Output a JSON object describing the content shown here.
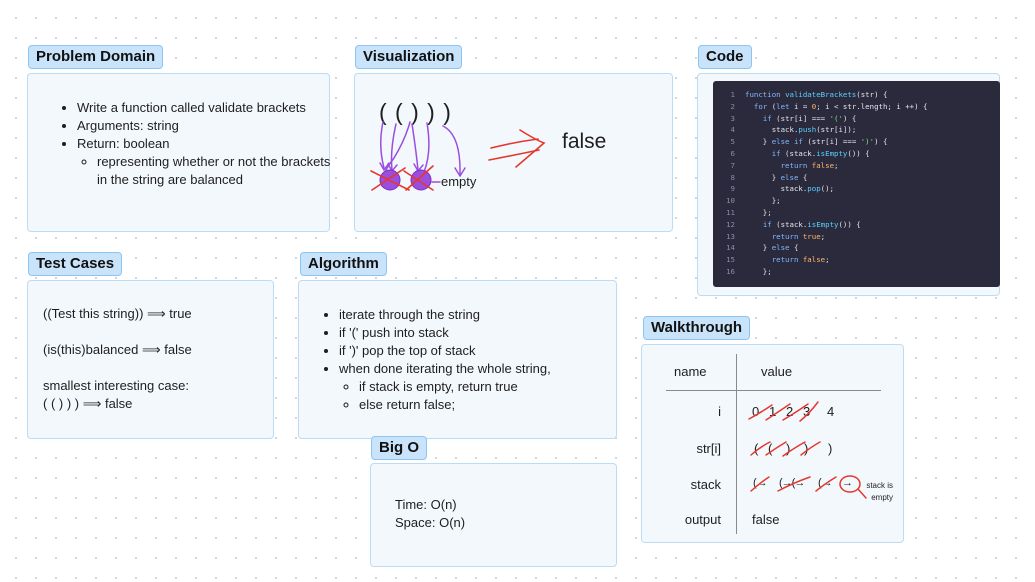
{
  "problem_domain": {
    "title": "Problem Domain",
    "items": [
      "Write a function called validate brackets",
      "Arguments: string",
      "Return: boolean"
    ],
    "sub_item": "representing whether or not the brackets in the string are balanced"
  },
  "visualization": {
    "title": "Visualization",
    "brackets": "( ( ) ) )",
    "empty_label": "empty",
    "result": "false"
  },
  "code": {
    "title": "Code",
    "lines": [
      {
        "n": "1",
        "t": "function validateBrackets(str) {"
      },
      {
        "n": "2",
        "t": "  for (let i = 0; i < str.length; i ++) {"
      },
      {
        "n": "3",
        "t": "    if (str[i] === '(') {"
      },
      {
        "n": "4",
        "t": "      stack.push(str[i]);"
      },
      {
        "n": "5",
        "t": "    } else if (str[i] === ')') {"
      },
      {
        "n": "6",
        "t": "      if (stack.isEmpty()) {"
      },
      {
        "n": "7",
        "t": "        return false;"
      },
      {
        "n": "8",
        "t": "      } else {"
      },
      {
        "n": "9",
        "t": "        stack.pop();"
      },
      {
        "n": "10",
        "t": "      };"
      },
      {
        "n": "11",
        "t": "    };"
      },
      {
        "n": "12",
        "t": "    if (stack.isEmpty()) {"
      },
      {
        "n": "13",
        "t": "      return true;"
      },
      {
        "n": "14",
        "t": "    } else {"
      },
      {
        "n": "15",
        "t": "      return false;"
      },
      {
        "n": "16",
        "t": "    };"
      }
    ]
  },
  "test_cases": {
    "title": "Test Cases",
    "case1": "((Test this string)) ⟹ true",
    "case2": "(is(this)balanced ⟹ false",
    "case3_label": "smallest interesting case:",
    "case3": "( ( ) ) ) ⟹ false"
  },
  "algorithm": {
    "title": "Algorithm",
    "items": [
      "iterate through the string",
      "if '(' push into stack",
      "if ')' pop the top of stack",
      "when done iterating the whole string,"
    ],
    "sub_items": [
      "if stack is empty, return true",
      "else return false;"
    ]
  },
  "big_o": {
    "title": "Big O",
    "time": "Time: O(n)",
    "space": "Space: O(n)"
  },
  "walkthrough": {
    "title": "Walkthrough",
    "header_name": "name",
    "header_value": "value",
    "row_i": "i",
    "i_values": [
      "0",
      "1",
      "2",
      "3",
      "4"
    ],
    "row_str": "str[i]",
    "str_values": [
      "(",
      "(",
      ")",
      ")",
      ")"
    ],
    "row_stack": "stack",
    "stack_values": [
      "(→",
      "(→(→",
      "(→",
      "→"
    ],
    "stack_note": "stack is empty",
    "row_output": "output",
    "output_value": "false"
  },
  "colors": {
    "tag_bg": "#c9e3fb",
    "card_bg": "#f3f8fd",
    "ink_red": "#e5382c",
    "ink_purple": "#9b4de0",
    "code_bg": "#2b2a3c"
  }
}
